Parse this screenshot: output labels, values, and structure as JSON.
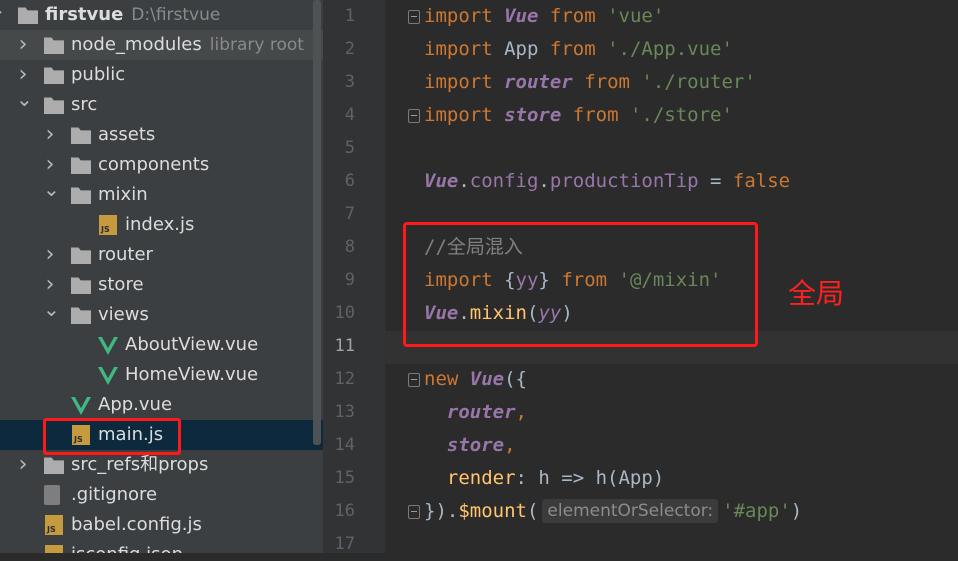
{
  "tree": {
    "items": [
      {
        "label": "firstvue",
        "hint": "D:\\firstvue",
        "icon": "folder-icon",
        "state": "expanded",
        "level": 0
      },
      {
        "label": "node_modules",
        "hint": "library root",
        "icon": "folder-icon",
        "state": "collapsed",
        "level": 1
      },
      {
        "label": "public",
        "hint": "",
        "icon": "folder-icon",
        "state": "collapsed",
        "level": 1
      },
      {
        "label": "src",
        "hint": "",
        "icon": "folder-icon",
        "state": "expanded",
        "level": 1
      },
      {
        "label": "assets",
        "hint": "",
        "icon": "folder-icon",
        "state": "collapsed",
        "level": 2
      },
      {
        "label": "components",
        "hint": "",
        "icon": "folder-icon",
        "state": "collapsed",
        "level": 2
      },
      {
        "label": "mixin",
        "hint": "",
        "icon": "folder-icon",
        "state": "expanded",
        "level": 2
      },
      {
        "label": "index.js",
        "hint": "",
        "icon": "js-file-icon",
        "state": "",
        "level": 3
      },
      {
        "label": "router",
        "hint": "",
        "icon": "folder-icon",
        "state": "collapsed",
        "level": 2
      },
      {
        "label": "store",
        "hint": "",
        "icon": "folder-icon",
        "state": "collapsed",
        "level": 2
      },
      {
        "label": "views",
        "hint": "",
        "icon": "folder-icon",
        "state": "expanded",
        "level": 2
      },
      {
        "label": "AboutView.vue",
        "hint": "",
        "icon": "vue-file-icon",
        "state": "",
        "level": 3
      },
      {
        "label": "HomeView.vue",
        "hint": "",
        "icon": "vue-file-icon",
        "state": "",
        "level": 3
      },
      {
        "label": "App.vue",
        "hint": "",
        "icon": "vue-file-icon",
        "state": "",
        "level": 2
      },
      {
        "label": "main.js",
        "hint": "",
        "icon": "js-file-icon",
        "state": "selected",
        "level": 2
      },
      {
        "label": "src_refs和props",
        "hint": "",
        "icon": "folder-icon",
        "state": "collapsed",
        "level": 1
      },
      {
        "label": ".gitignore",
        "hint": "",
        "icon": "git-file-icon",
        "state": "",
        "level": 1
      },
      {
        "label": "babel.config.js",
        "hint": "",
        "icon": "js-file-icon",
        "state": "",
        "level": 1
      },
      {
        "label": "jsconfig.json",
        "hint": "",
        "icon": "json-file-icon",
        "state": "",
        "level": 1
      }
    ]
  },
  "editor": {
    "line_numbers": [
      "1",
      "2",
      "3",
      "4",
      "5",
      "6",
      "7",
      "8",
      "9",
      "10",
      "11",
      "12",
      "13",
      "14",
      "15",
      "16",
      "17"
    ],
    "current_line": "11",
    "lines": {
      "l1": {
        "kw": "import",
        "id": "Vue",
        "from": "from",
        "str": "'vue'"
      },
      "l2": {
        "kw": "import",
        "id": "App",
        "from": "from",
        "str": "'./App.vue'"
      },
      "l3": {
        "kw": "import",
        "id": "router",
        "from": "from",
        "str": "'./router'"
      },
      "l4": {
        "kw": "import",
        "id": "store",
        "from": "from",
        "str": "'./store'"
      },
      "l6": {
        "obj": "Vue",
        "dot1": ".",
        "p1": "config",
        "dot2": ".",
        "p2": "productionTip",
        "eq": " = ",
        "val": "false"
      },
      "l8": {
        "comment": "//全局混入"
      },
      "l9": {
        "kw": "import",
        "open": " {",
        "id": "yy",
        "close": "} ",
        "from": "from",
        "str": "'@/mixin'"
      },
      "l10": {
        "obj": "Vue",
        "dot": ".",
        "fn": "mixin",
        "open": "(",
        "arg": "yy",
        "close": ")"
      },
      "l12": {
        "kw": "new",
        "cls": "Vue",
        "rest": "({"
      },
      "l13": {
        "prop": "router",
        "comma": ","
      },
      "l14": {
        "prop": "store",
        "comma": ","
      },
      "l15": {
        "key": "render",
        "rest": ": h => h(App)"
      },
      "l16": {
        "start": "}).",
        "fn": "$mount",
        "open": "(",
        "hint": "elementOrSelector:",
        "str": "'#app'",
        "close": ")"
      }
    }
  },
  "annotation": {
    "text": "全局"
  },
  "colors": {
    "highlight_box": "#ff1a1a",
    "selection": "#0d293e",
    "keyword": "#cc7832",
    "string": "#6a8759",
    "purple": "#9876aa",
    "vue_green": "#41b883"
  }
}
